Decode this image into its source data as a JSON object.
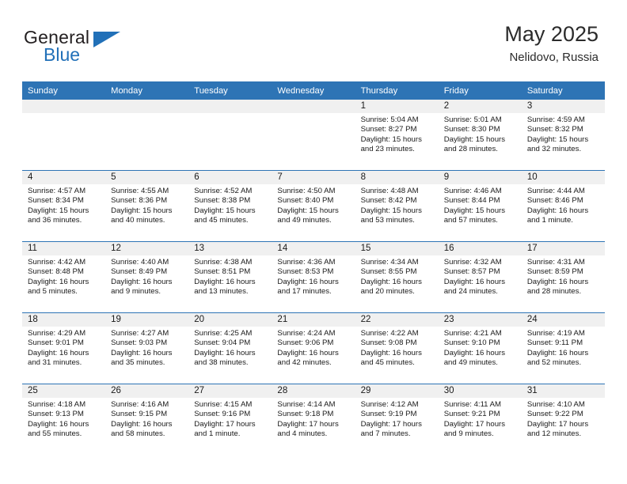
{
  "brand": {
    "name_part1": "General",
    "name_part2": "Blue",
    "logo_icon": "triangle-icon",
    "accent_color": "#2170b8"
  },
  "header": {
    "title": "May 2025",
    "location": "Nelidovo, Russia"
  },
  "theme": {
    "header_blue": "#2e74b5",
    "daynum_band": "#f0f0f0",
    "text": "#1a1a1a"
  },
  "calendar": {
    "weekday_headers": [
      "Sunday",
      "Monday",
      "Tuesday",
      "Wednesday",
      "Thursday",
      "Friday",
      "Saturday"
    ],
    "weeks": [
      [
        {
          "day": "",
          "lines": []
        },
        {
          "day": "",
          "lines": []
        },
        {
          "day": "",
          "lines": []
        },
        {
          "day": "",
          "lines": []
        },
        {
          "day": "1",
          "lines": [
            "Sunrise: 5:04 AM",
            "Sunset: 8:27 PM",
            "Daylight: 15 hours",
            "and 23 minutes."
          ]
        },
        {
          "day": "2",
          "lines": [
            "Sunrise: 5:01 AM",
            "Sunset: 8:30 PM",
            "Daylight: 15 hours",
            "and 28 minutes."
          ]
        },
        {
          "day": "3",
          "lines": [
            "Sunrise: 4:59 AM",
            "Sunset: 8:32 PM",
            "Daylight: 15 hours",
            "and 32 minutes."
          ]
        }
      ],
      [
        {
          "day": "4",
          "lines": [
            "Sunrise: 4:57 AM",
            "Sunset: 8:34 PM",
            "Daylight: 15 hours",
            "and 36 minutes."
          ]
        },
        {
          "day": "5",
          "lines": [
            "Sunrise: 4:55 AM",
            "Sunset: 8:36 PM",
            "Daylight: 15 hours",
            "and 40 minutes."
          ]
        },
        {
          "day": "6",
          "lines": [
            "Sunrise: 4:52 AM",
            "Sunset: 8:38 PM",
            "Daylight: 15 hours",
            "and 45 minutes."
          ]
        },
        {
          "day": "7",
          "lines": [
            "Sunrise: 4:50 AM",
            "Sunset: 8:40 PM",
            "Daylight: 15 hours",
            "and 49 minutes."
          ]
        },
        {
          "day": "8",
          "lines": [
            "Sunrise: 4:48 AM",
            "Sunset: 8:42 PM",
            "Daylight: 15 hours",
            "and 53 minutes."
          ]
        },
        {
          "day": "9",
          "lines": [
            "Sunrise: 4:46 AM",
            "Sunset: 8:44 PM",
            "Daylight: 15 hours",
            "and 57 minutes."
          ]
        },
        {
          "day": "10",
          "lines": [
            "Sunrise: 4:44 AM",
            "Sunset: 8:46 PM",
            "Daylight: 16 hours",
            "and 1 minute."
          ]
        }
      ],
      [
        {
          "day": "11",
          "lines": [
            "Sunrise: 4:42 AM",
            "Sunset: 8:48 PM",
            "Daylight: 16 hours",
            "and 5 minutes."
          ]
        },
        {
          "day": "12",
          "lines": [
            "Sunrise: 4:40 AM",
            "Sunset: 8:49 PM",
            "Daylight: 16 hours",
            "and 9 minutes."
          ]
        },
        {
          "day": "13",
          "lines": [
            "Sunrise: 4:38 AM",
            "Sunset: 8:51 PM",
            "Daylight: 16 hours",
            "and 13 minutes."
          ]
        },
        {
          "day": "14",
          "lines": [
            "Sunrise: 4:36 AM",
            "Sunset: 8:53 PM",
            "Daylight: 16 hours",
            "and 17 minutes."
          ]
        },
        {
          "day": "15",
          "lines": [
            "Sunrise: 4:34 AM",
            "Sunset: 8:55 PM",
            "Daylight: 16 hours",
            "and 20 minutes."
          ]
        },
        {
          "day": "16",
          "lines": [
            "Sunrise: 4:32 AM",
            "Sunset: 8:57 PM",
            "Daylight: 16 hours",
            "and 24 minutes."
          ]
        },
        {
          "day": "17",
          "lines": [
            "Sunrise: 4:31 AM",
            "Sunset: 8:59 PM",
            "Daylight: 16 hours",
            "and 28 minutes."
          ]
        }
      ],
      [
        {
          "day": "18",
          "lines": [
            "Sunrise: 4:29 AM",
            "Sunset: 9:01 PM",
            "Daylight: 16 hours",
            "and 31 minutes."
          ]
        },
        {
          "day": "19",
          "lines": [
            "Sunrise: 4:27 AM",
            "Sunset: 9:03 PM",
            "Daylight: 16 hours",
            "and 35 minutes."
          ]
        },
        {
          "day": "20",
          "lines": [
            "Sunrise: 4:25 AM",
            "Sunset: 9:04 PM",
            "Daylight: 16 hours",
            "and 38 minutes."
          ]
        },
        {
          "day": "21",
          "lines": [
            "Sunrise: 4:24 AM",
            "Sunset: 9:06 PM",
            "Daylight: 16 hours",
            "and 42 minutes."
          ]
        },
        {
          "day": "22",
          "lines": [
            "Sunrise: 4:22 AM",
            "Sunset: 9:08 PM",
            "Daylight: 16 hours",
            "and 45 minutes."
          ]
        },
        {
          "day": "23",
          "lines": [
            "Sunrise: 4:21 AM",
            "Sunset: 9:10 PM",
            "Daylight: 16 hours",
            "and 49 minutes."
          ]
        },
        {
          "day": "24",
          "lines": [
            "Sunrise: 4:19 AM",
            "Sunset: 9:11 PM",
            "Daylight: 16 hours",
            "and 52 minutes."
          ]
        }
      ],
      [
        {
          "day": "25",
          "lines": [
            "Sunrise: 4:18 AM",
            "Sunset: 9:13 PM",
            "Daylight: 16 hours",
            "and 55 minutes."
          ]
        },
        {
          "day": "26",
          "lines": [
            "Sunrise: 4:16 AM",
            "Sunset: 9:15 PM",
            "Daylight: 16 hours",
            "and 58 minutes."
          ]
        },
        {
          "day": "27",
          "lines": [
            "Sunrise: 4:15 AM",
            "Sunset: 9:16 PM",
            "Daylight: 17 hours",
            "and 1 minute."
          ]
        },
        {
          "day": "28",
          "lines": [
            "Sunrise: 4:14 AM",
            "Sunset: 9:18 PM",
            "Daylight: 17 hours",
            "and 4 minutes."
          ]
        },
        {
          "day": "29",
          "lines": [
            "Sunrise: 4:12 AM",
            "Sunset: 9:19 PM",
            "Daylight: 17 hours",
            "and 7 minutes."
          ]
        },
        {
          "day": "30",
          "lines": [
            "Sunrise: 4:11 AM",
            "Sunset: 9:21 PM",
            "Daylight: 17 hours",
            "and 9 minutes."
          ]
        },
        {
          "day": "31",
          "lines": [
            "Sunrise: 4:10 AM",
            "Sunset: 9:22 PM",
            "Daylight: 17 hours",
            "and 12 minutes."
          ]
        }
      ]
    ]
  }
}
